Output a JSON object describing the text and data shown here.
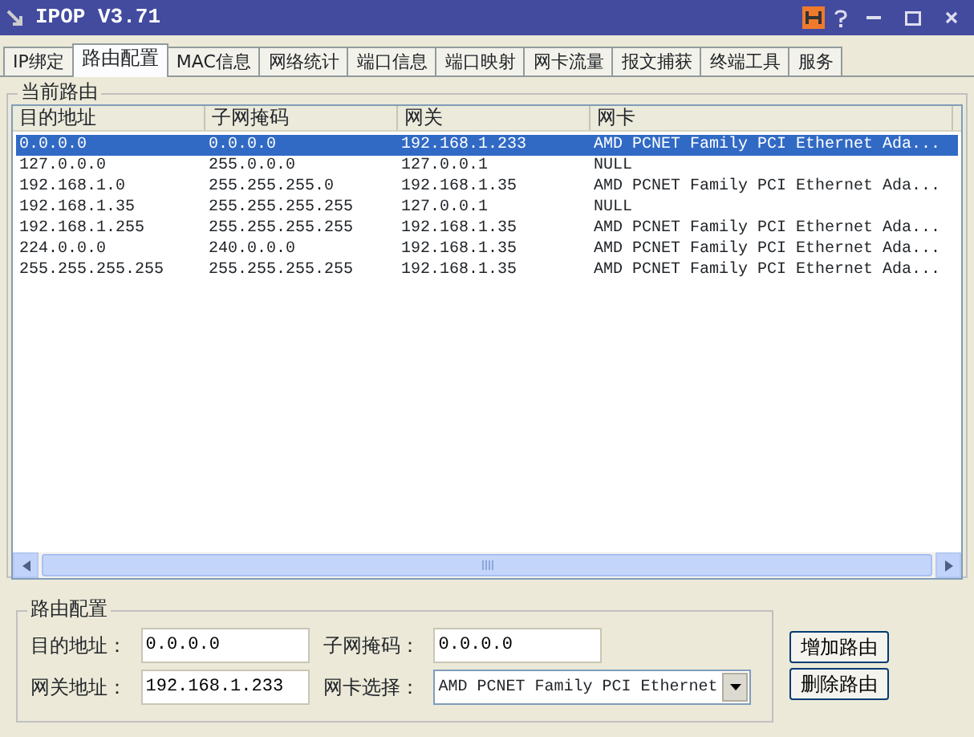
{
  "window": {
    "title": "IPOP V3.71"
  },
  "tabs": [
    {
      "label": "IP绑定",
      "selected": false
    },
    {
      "label": "路由配置",
      "selected": true
    },
    {
      "label": "MAC信息",
      "selected": false
    },
    {
      "label": "网络统计",
      "selected": false
    },
    {
      "label": "端口信息",
      "selected": false
    },
    {
      "label": "端口映射",
      "selected": false
    },
    {
      "label": "网卡流量",
      "selected": false
    },
    {
      "label": "报文捕获",
      "selected": false
    },
    {
      "label": "终端工具",
      "selected": false
    },
    {
      "label": "服务",
      "selected": false
    }
  ],
  "routes_group": {
    "title": "当前路由",
    "table": {
      "columns": [
        "目的地址",
        "子网掩码",
        "网关",
        "网卡"
      ],
      "rows": [
        {
          "cells": [
            "0.0.0.0",
            "0.0.0.0",
            "192.168.1.233",
            "AMD PCNET Family PCI Ethernet Ada..."
          ],
          "selected": true
        },
        {
          "cells": [
            "127.0.0.0",
            "255.0.0.0",
            "127.0.0.1",
            "NULL"
          ],
          "selected": false
        },
        {
          "cells": [
            "192.168.1.0",
            "255.255.255.0",
            "192.168.1.35",
            "AMD PCNET Family PCI Ethernet Ada..."
          ],
          "selected": false
        },
        {
          "cells": [
            "192.168.1.35",
            "255.255.255.255",
            "127.0.0.1",
            "NULL"
          ],
          "selected": false
        },
        {
          "cells": [
            "192.168.1.255",
            "255.255.255.255",
            "192.168.1.35",
            "AMD PCNET Family PCI Ethernet Ada..."
          ],
          "selected": false
        },
        {
          "cells": [
            "224.0.0.0",
            "240.0.0.0",
            "192.168.1.35",
            "AMD PCNET Family PCI Ethernet Ada..."
          ],
          "selected": false
        },
        {
          "cells": [
            "255.255.255.255",
            "255.255.255.255",
            "192.168.1.35",
            "AMD PCNET Family PCI Ethernet Ada..."
          ],
          "selected": false
        }
      ]
    }
  },
  "config_group": {
    "title": "路由配置",
    "fields": [
      {
        "label": "目的地址：",
        "value": "0.0.0.0",
        "kind": "text"
      },
      {
        "label": "子网掩码：",
        "value": "0.0.0.0",
        "kind": "text"
      },
      {
        "label": "网关地址：",
        "value": "192.168.1.233",
        "kind": "text"
      },
      {
        "label": "网卡选择：",
        "value": "AMD PCNET Family PCI Ethernet",
        "kind": "select"
      }
    ]
  },
  "buttons": [
    "增加路由",
    "删除路由"
  ]
}
